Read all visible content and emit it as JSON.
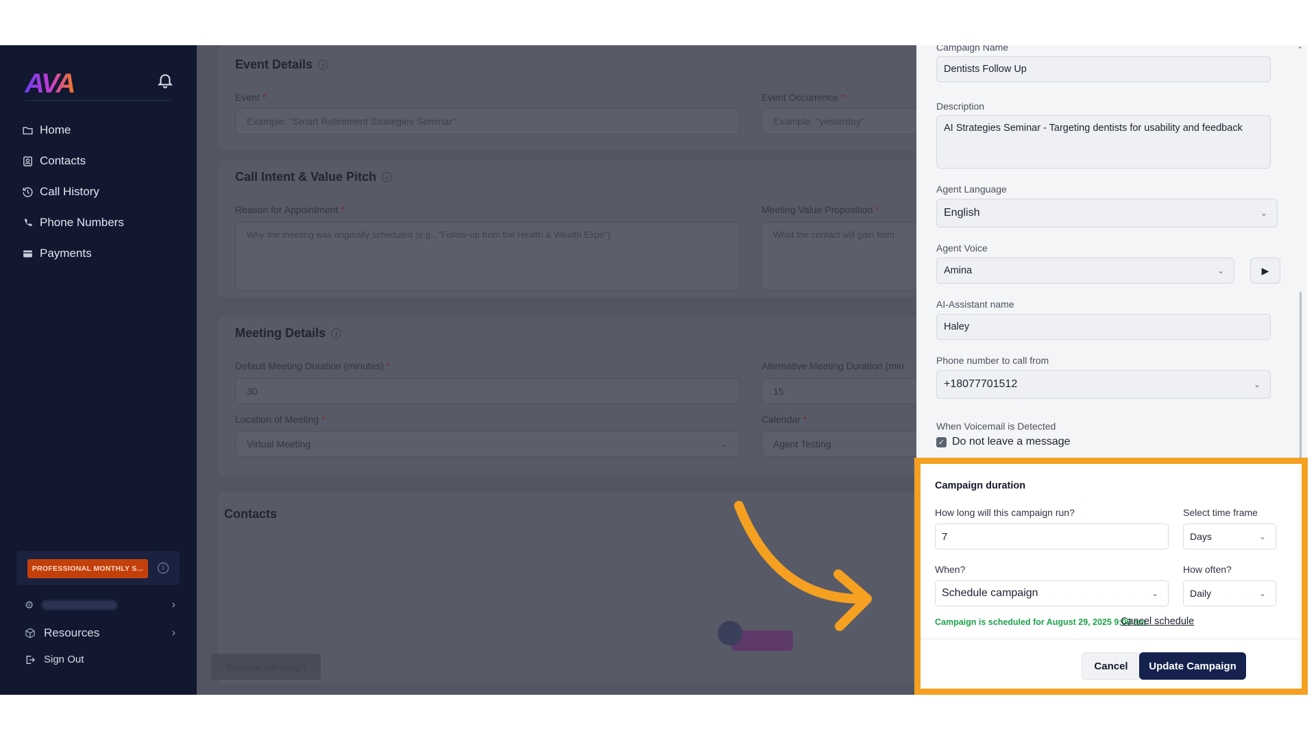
{
  "colors": {
    "sidebar": "#111830",
    "accent_orange": "#f5a021",
    "primary_button": "#14224d",
    "success_text": "#1ea24a",
    "plan_badge": "#c3400b"
  },
  "sidebar": {
    "logo": "AVA",
    "nav": [
      {
        "label": "Home",
        "icon": "folder-icon"
      },
      {
        "label": "Contacts",
        "icon": "contacts-icon"
      },
      {
        "label": "Call History",
        "icon": "history-icon"
      },
      {
        "label": "Phone Numbers",
        "icon": "phone-icon"
      },
      {
        "label": "Payments",
        "icon": "card-icon"
      }
    ],
    "plan_badge": "PROFESSIONAL MONTHLY S...",
    "resources": "Resources",
    "sign_out": "Sign Out"
  },
  "main": {
    "event_details": {
      "title": "Event Details",
      "event_label": "Event",
      "event_placeholder": "Example: \"Smart Retirement Strategies Seminar\"",
      "occurrence_label": "Event Occurrence",
      "occurrence_placeholder": "Example: \"yesterday\""
    },
    "call_intent": {
      "title": "Call Intent & Value Pitch",
      "reason_label": "Reason for Appointment",
      "reason_placeholder": "Why the meeting was originally scheduled (e.g., \"Follow-up from the Health & Wealth Expo\")",
      "value_label": "Meeting Value Proposition",
      "value_placeholder": "What the contact will gain from"
    },
    "meeting_details": {
      "title": "Meeting Details",
      "default_duration_label": "Default Meeting Duration (minutes)",
      "default_duration_value": "30",
      "alt_duration_label": "Alternative Meeting Duration (min",
      "alt_duration_value": "15",
      "location_label": "Location of Meeting",
      "location_value": "Virtual Meeting",
      "calendar_label": "Calendar",
      "calendar_value": "Agent Testing"
    },
    "contacts_title": "Contacts",
    "execute_button": "Execute campaign"
  },
  "panel": {
    "campaign_name_label": "Campaign Name",
    "campaign_name_value": "Dentists Follow Up",
    "description_label": "Description",
    "description_value": "AI Strategies Seminar - Targeting dentists for usability and feedback",
    "agent_language_label": "Agent Language",
    "agent_language_value": "English",
    "agent_voice_label": "Agent Voice",
    "agent_voice_value": "Amina",
    "assistant_name_label": "AI-Assistant name",
    "assistant_name_value": "Haley",
    "phone_label": "Phone number to call from",
    "phone_value": "+18077701512",
    "voicemail_label": "When Voicemail is Detected",
    "voicemail_option": "Do not leave a message"
  },
  "duration": {
    "title": "Campaign duration",
    "run_label": "How long will this campaign run?",
    "run_value": "7",
    "timeframe_label": "Select time frame",
    "timeframe_value": "Days",
    "when_label": "When?",
    "when_value": "Schedule campaign",
    "how_often_label": "How often?",
    "how_often_value": "Daily",
    "scheduled_message": "Campaign is scheduled for August 29, 2025 9:00 am",
    "cancel_schedule": "Cancel schedule",
    "cancel_button": "Cancel",
    "update_button": "Update Campaign"
  }
}
